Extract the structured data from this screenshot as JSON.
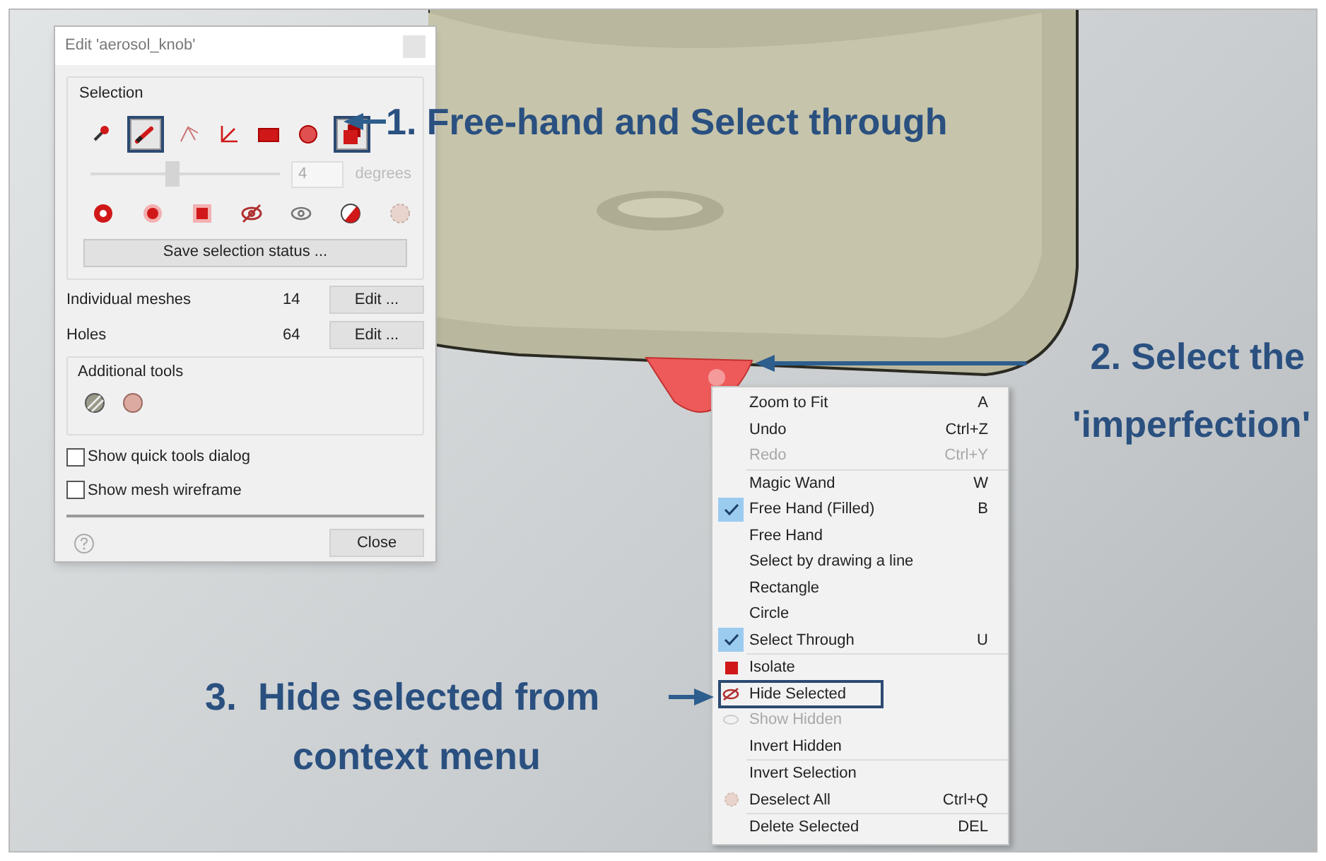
{
  "dialog": {
    "title": "Edit 'aerosol_knob'",
    "selection_label": "Selection",
    "tools": [
      {
        "selected": false
      },
      {
        "selected": true
      },
      {
        "selected": false
      },
      {
        "selected": false
      },
      {
        "selected": false
      },
      {
        "selected": false
      },
      {
        "selected": true
      }
    ],
    "angle": {
      "level": 0.43,
      "value": "4",
      "unit": "degrees",
      "disabled": true
    },
    "save_button": "Save selection status ...",
    "rows": [
      {
        "label": "Individual meshes",
        "count": "14",
        "button": "Edit ..."
      },
      {
        "label": "Holes",
        "count": "64",
        "button": "Edit ..."
      }
    ],
    "additional_tools_label": "Additional tools",
    "checkboxes": [
      {
        "label": "Show quick tools dialog",
        "checked": false
      },
      {
        "label": "Show mesh wireframe",
        "checked": false
      }
    ],
    "close_button": "Close"
  },
  "context_menu": [
    [
      {
        "label": "Zoom to Fit",
        "shortcut": "A",
        "checked": false,
        "disabled": false,
        "highlighted": false
      },
      {
        "label": "Undo",
        "shortcut": "Ctrl+Z",
        "checked": false,
        "disabled": false,
        "highlighted": false
      },
      {
        "label": "Redo",
        "shortcut": "Ctrl+Y",
        "checked": false,
        "disabled": true,
        "highlighted": false
      }
    ],
    [
      {
        "label": "Magic Wand",
        "shortcut": "W",
        "checked": false,
        "disabled": false,
        "highlighted": false
      },
      {
        "label": "Free Hand (Filled)",
        "shortcut": "B",
        "checked": true,
        "disabled": false,
        "highlighted": false
      },
      {
        "label": "Free Hand",
        "checked": false,
        "disabled": false,
        "highlighted": false
      },
      {
        "label": "Select by drawing a line",
        "checked": false,
        "disabled": false,
        "highlighted": false
      },
      {
        "label": "Rectangle",
        "checked": false,
        "disabled": false,
        "highlighted": false
      },
      {
        "label": "Circle",
        "checked": false,
        "disabled": false,
        "highlighted": false
      },
      {
        "label": "Select Through",
        "shortcut": "U",
        "checked": true,
        "disabled": false,
        "highlighted": false
      }
    ],
    [
      {
        "label": "Isolate",
        "checked": false,
        "disabled": false,
        "highlighted": false
      },
      {
        "label": "Hide Selected",
        "checked": false,
        "disabled": false,
        "highlighted": true
      },
      {
        "label": "Show Hidden",
        "checked": false,
        "disabled": true,
        "highlighted": false
      },
      {
        "label": "Invert Hidden",
        "checked": false,
        "disabled": false,
        "highlighted": false
      }
    ],
    [
      {
        "label": "Invert Selection",
        "checked": false,
        "disabled": false,
        "highlighted": false
      },
      {
        "label": "Deselect All",
        "shortcut": "Ctrl+Q",
        "checked": false,
        "disabled": false,
        "highlighted": false
      }
    ],
    [
      {
        "label": "Delete Selected",
        "shortcut": "DEL",
        "checked": false,
        "disabled": false,
        "highlighted": false
      }
    ]
  ],
  "annotations": {
    "step_1": "1. Free-hand and Select through",
    "step_2": [
      "2. Select the",
      "'imperfection'"
    ],
    "step_3": [
      "3.  Hide selected from",
      "context menu"
    ]
  }
}
